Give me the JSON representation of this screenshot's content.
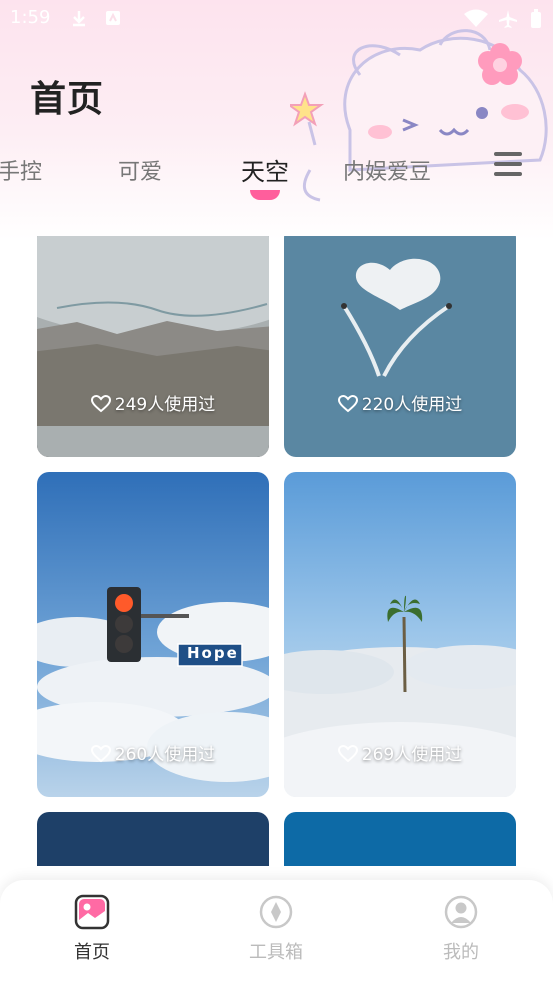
{
  "status_bar": {
    "time": "1:59"
  },
  "header": {
    "title": "首页"
  },
  "tabs": [
    {
      "label": "手控"
    },
    {
      "label": "可爱"
    },
    {
      "label": "天空"
    },
    {
      "label": "内娱爱豆"
    }
  ],
  "cards": [
    {
      "usage": "249人使用过",
      "scene": "aerial-window"
    },
    {
      "usage": "220人使用过",
      "scene": "heart-cloud"
    },
    {
      "usage": "260人使用过",
      "scene": "traffic-light-hope",
      "sign_text": "Hope"
    },
    {
      "usage": "269人使用过",
      "scene": "palm-tree-clouds"
    },
    {
      "scene": "dark-blue-sky"
    },
    {
      "scene": "blue-sky"
    }
  ],
  "bottom_nav": [
    {
      "label": "首页",
      "icon": "image-icon",
      "active": true
    },
    {
      "label": "工具箱",
      "icon": "compass-icon",
      "active": false
    },
    {
      "label": "我的",
      "icon": "user-icon",
      "active": false
    }
  ],
  "colors": {
    "accent": "#ff5e9c",
    "header_bg": "#fde3ee",
    "card_label": "#ffffff"
  }
}
